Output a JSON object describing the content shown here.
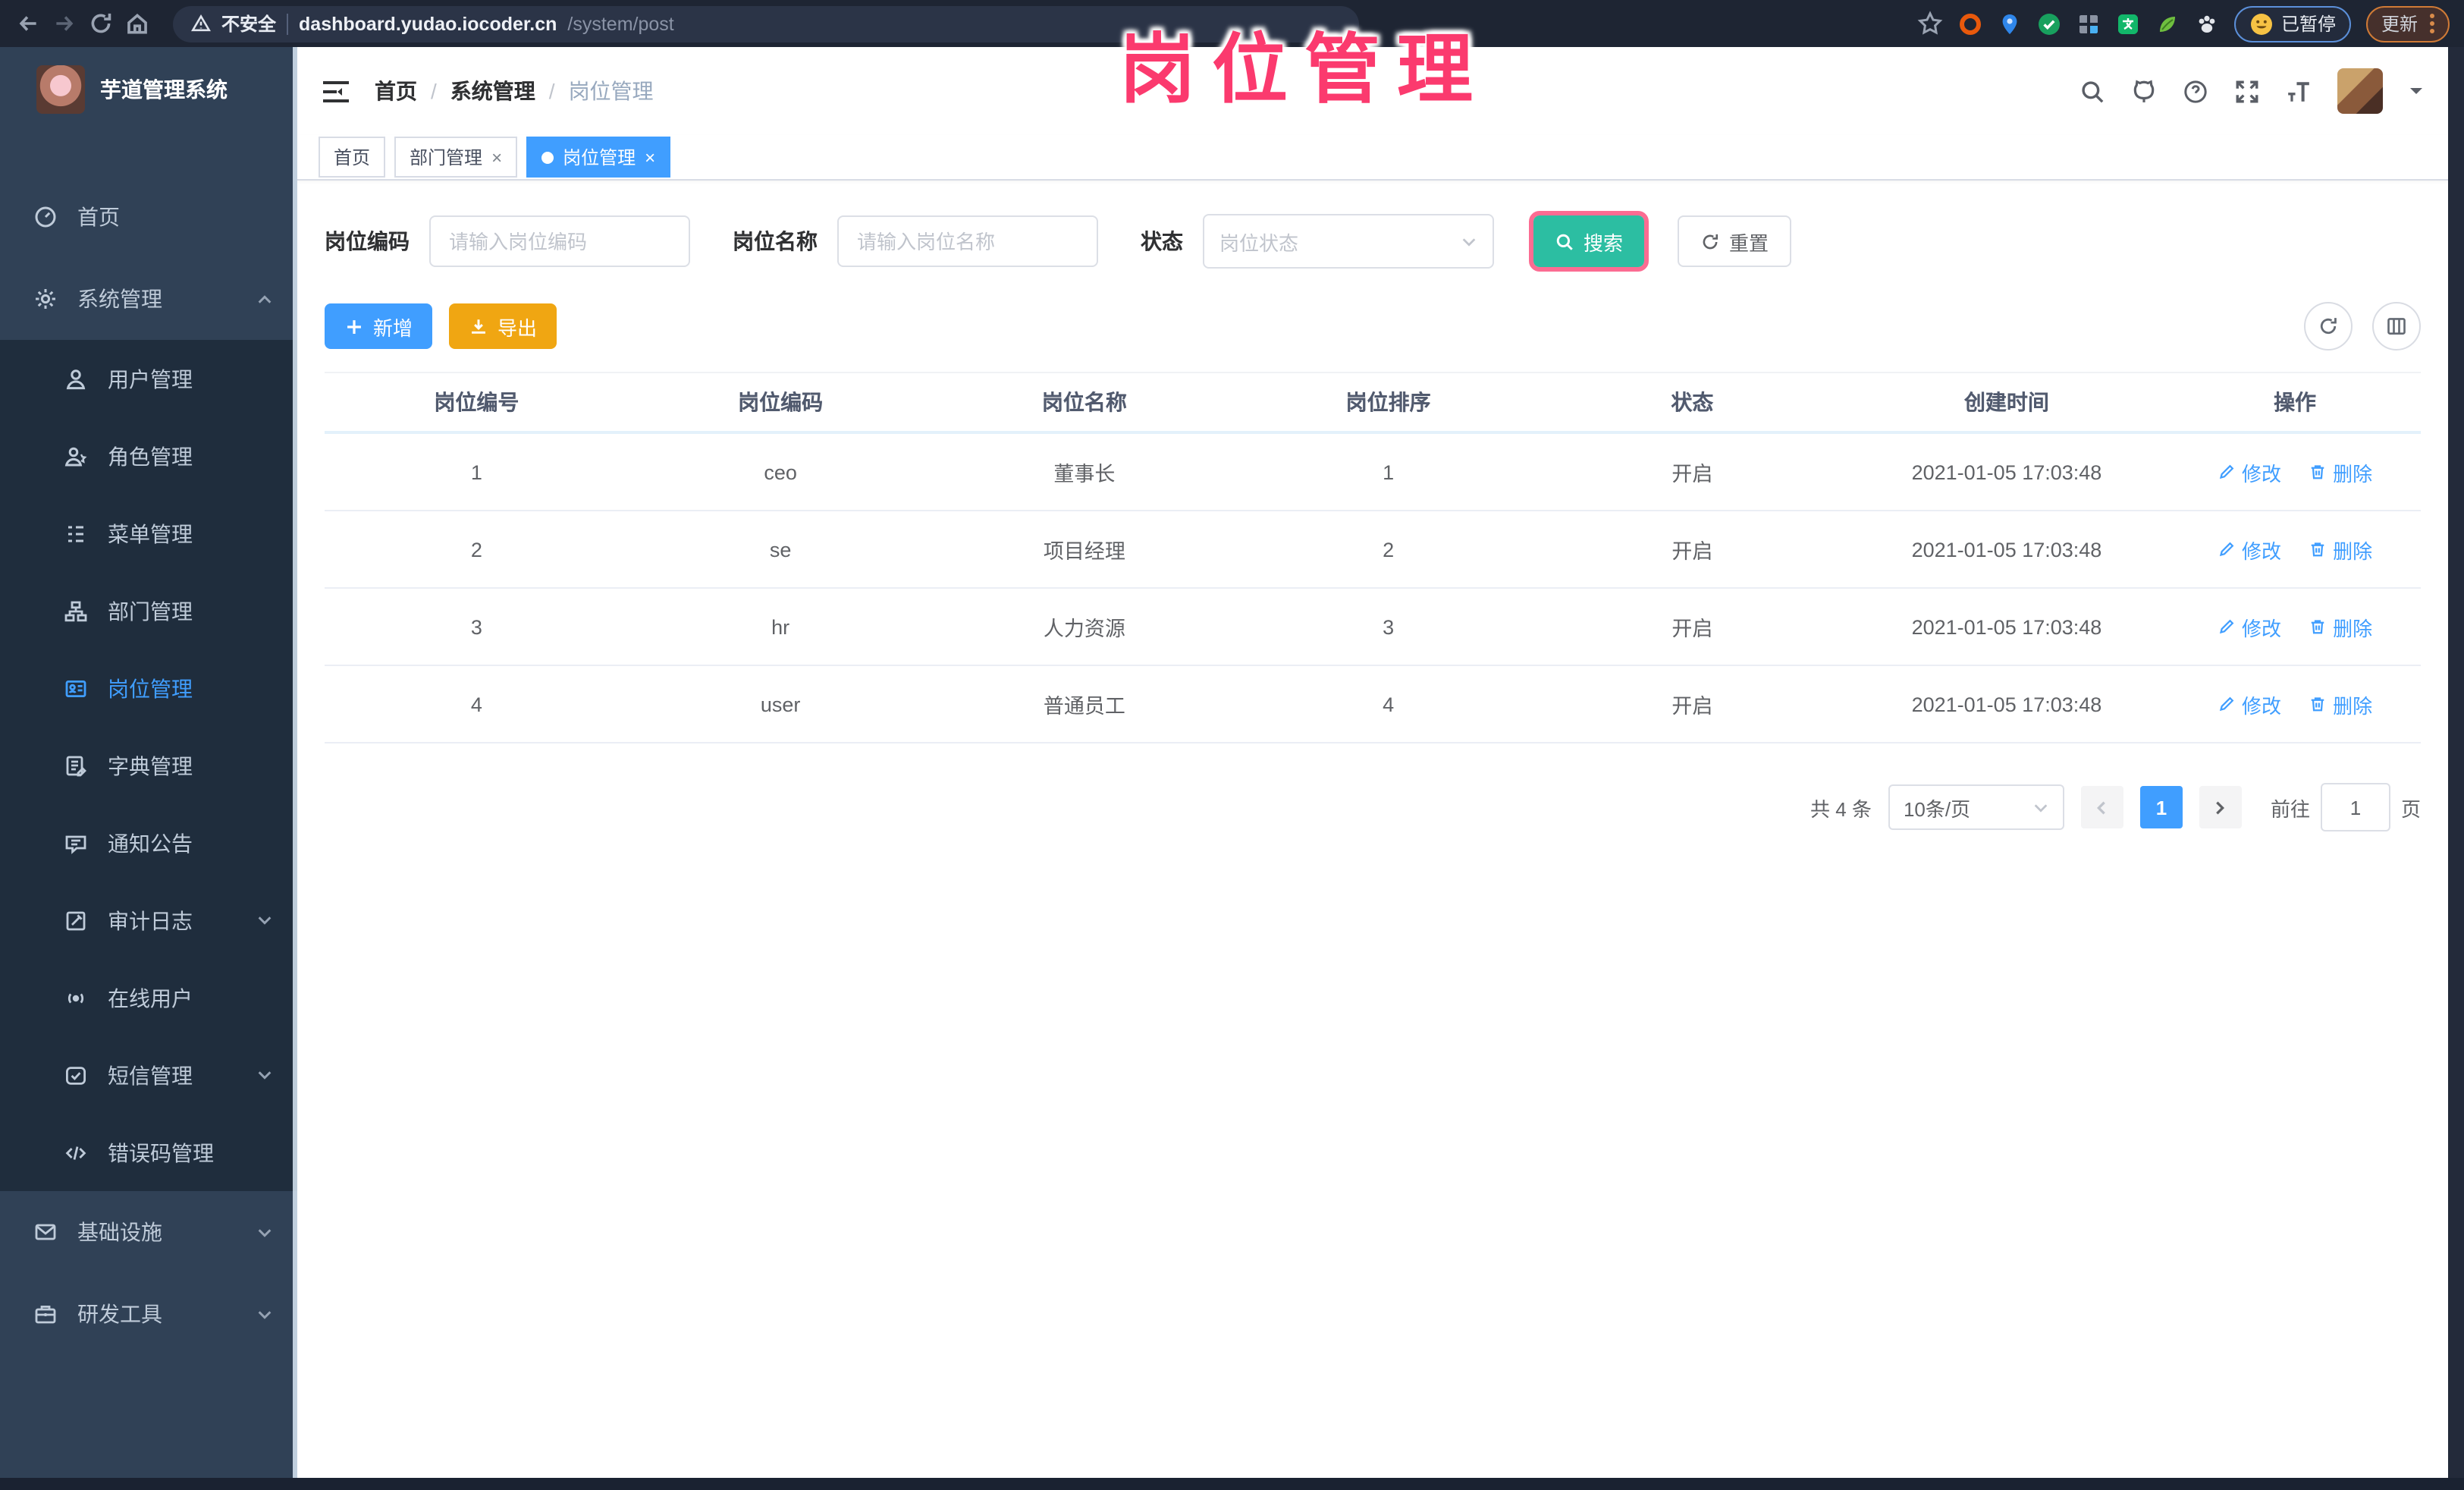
{
  "palette": {
    "accent": "#409eff",
    "search_teal": "#2cbea2",
    "export_amber": "#f0a612",
    "annotation_pink": "#fb3a6e",
    "sidebar_bg": "#304156",
    "submenu_bg": "#1f2d3d",
    "chrome_bg": "#1e2533"
  },
  "browser": {
    "security_label": "不安全",
    "url_host": "dashboard.yudao.iocoder.cn",
    "url_path": "/system/post",
    "paused_label": "已暂停",
    "update_label": "更新"
  },
  "annotation": {
    "text": "岗位管理"
  },
  "sidebar": {
    "app_title": "芋道管理系统",
    "home": "首页",
    "system": "系统管理",
    "user": "用户管理",
    "role": "角色管理",
    "menu": "菜单管理",
    "dept": "部门管理",
    "post": "岗位管理",
    "dict": "字典管理",
    "notice": "通知公告",
    "audit": "审计日志",
    "online": "在线用户",
    "sms": "短信管理",
    "errcode": "错误码管理",
    "infra": "基础设施",
    "devtools": "研发工具"
  },
  "breadcrumb": {
    "home": "首页",
    "system": "系统管理",
    "current": "岗位管理"
  },
  "tabs": {
    "home": "首页",
    "dept": "部门管理",
    "post": "岗位管理"
  },
  "filters": {
    "code_label": "岗位编码",
    "code_placeholder": "请输入岗位编码",
    "name_label": "岗位名称",
    "name_placeholder": "请输入岗位名称",
    "status_label": "状态",
    "status_placeholder": "岗位状态",
    "search_label": "搜索",
    "reset_label": "重置"
  },
  "toolbar": {
    "add_label": "新增",
    "export_label": "导出"
  },
  "table": {
    "headers": [
      "岗位编号",
      "岗位编码",
      "岗位名称",
      "岗位排序",
      "状态",
      "创建时间",
      "操作"
    ],
    "rows": [
      {
        "id": "1",
        "code": "ceo",
        "name": "董事长",
        "sort": "1",
        "status": "开启",
        "created": "2021-01-05 17:03:48"
      },
      {
        "id": "2",
        "code": "se",
        "name": "项目经理",
        "sort": "2",
        "status": "开启",
        "created": "2021-01-05 17:03:48"
      },
      {
        "id": "3",
        "code": "hr",
        "name": "人力资源",
        "sort": "3",
        "status": "开启",
        "created": "2021-01-05 17:03:48"
      },
      {
        "id": "4",
        "code": "user",
        "name": "普通员工",
        "sort": "4",
        "status": "开启",
        "created": "2021-01-05 17:03:48"
      }
    ],
    "edit_label": "修改",
    "delete_label": "删除"
  },
  "pagination": {
    "total": "共 4 条",
    "page_size": "10条/页",
    "current_page": "1",
    "goto_label": "前往",
    "goto_value": "1",
    "page_unit": "页"
  }
}
